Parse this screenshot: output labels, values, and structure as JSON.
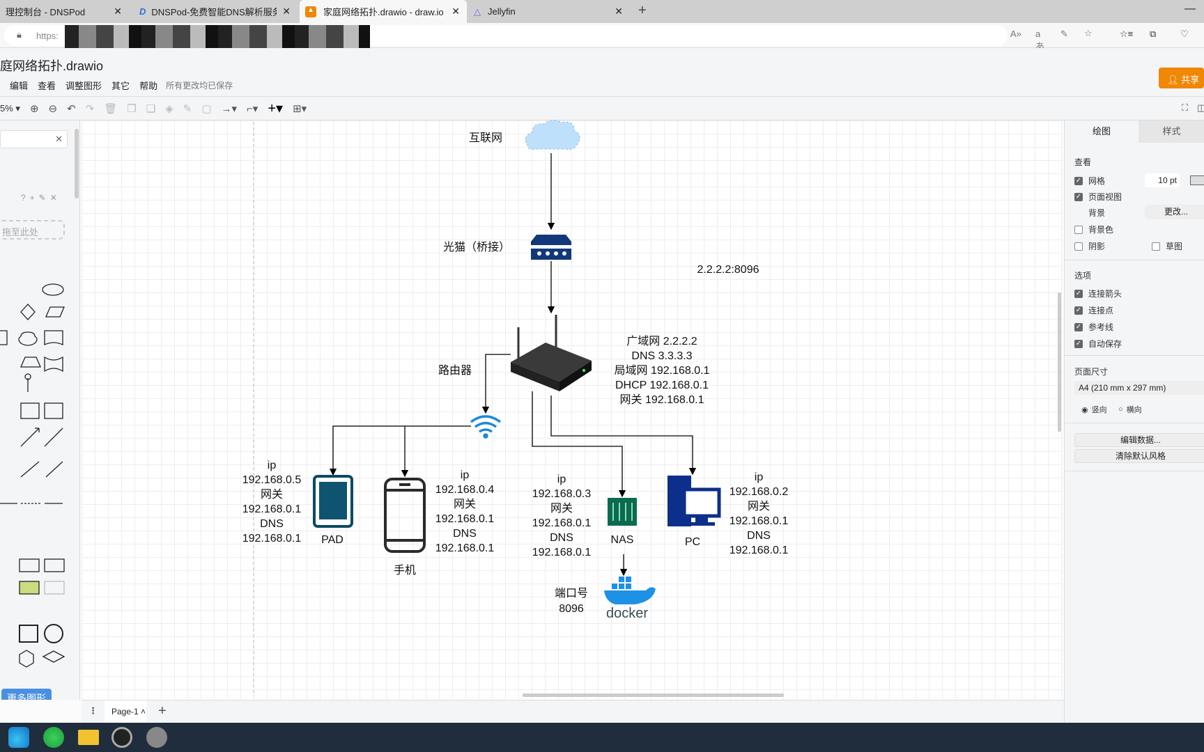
{
  "browser": {
    "tabs": [
      {
        "label": "理控制台 - DNSPod"
      },
      {
        "label": "DNSPod-免费智能DNS解析服务"
      },
      {
        "label": "家庭网络拓扑.drawio - draw.io"
      },
      {
        "label": "Jellyfin"
      }
    ],
    "url_prefix": "https:"
  },
  "app": {
    "file_title": "庭网络拓扑.drawio",
    "menu": [
      "编辑",
      "查看",
      "调整图形",
      "其它",
      "帮助"
    ],
    "save_status": "所有更改均已保存",
    "share_label": "共享",
    "zoom": "5%"
  },
  "sidebar": {
    "drop_hint": "拖至此处",
    "more_shapes": "更多图形"
  },
  "right_panel": {
    "tabs": [
      "绘图",
      "样式"
    ],
    "view_section": "查看",
    "grid": "网格",
    "grid_size": "10 pt",
    "page_view": "页面视图",
    "background": "背景",
    "change": "更改...",
    "background_color": "背景色",
    "shadow": "阴影",
    "sketch": "草图",
    "options_section": "选项",
    "connection_arrows": "连接箭头",
    "connection_points": "连接点",
    "guides": "参考线",
    "autosave": "自动保存",
    "page_size_section": "页面尺寸",
    "page_size": "A4 (210 mm x 297 mm)",
    "portrait": "竖向",
    "landscape": "横向",
    "edit_data": "编辑数据...",
    "clear_style": "清除默认风格"
  },
  "page_bar": {
    "page": "Page-1"
  },
  "diagram": {
    "internet": "互联网",
    "modem": "光猫（桥接）",
    "port_map": "2.2.2.2:8096",
    "router": "路由器",
    "router_info": [
      "广域网 2.2.2.2",
      "DNS 3.3.3.3",
      "局域网 192.168.0.1",
      "DHCP 192.168.0.1",
      "网关 192.168.0.1"
    ],
    "pad": {
      "label": "PAD",
      "info": [
        "ip",
        "192.168.0.5",
        "网关",
        "192.168.0.1",
        "DNS",
        "192.168.0.1"
      ]
    },
    "phone": {
      "label": "手机",
      "info": [
        "ip",
        "192.168.0.4",
        "网关",
        "192.168.0.1",
        "DNS",
        "192.168.0.1"
      ]
    },
    "nas": {
      "label": "NAS",
      "info": [
        "ip",
        "192.168.0.3",
        "网关",
        "192.168.0.1",
        "DNS",
        "192.168.0.1"
      ]
    },
    "pc": {
      "label": "PC",
      "info": [
        "ip",
        "192.168.0.2",
        "网关",
        "192.168.0.1",
        "DNS",
        "192.168.0.1"
      ]
    },
    "docker": {
      "label": "docker",
      "port": [
        "端口号",
        "8096"
      ]
    }
  }
}
